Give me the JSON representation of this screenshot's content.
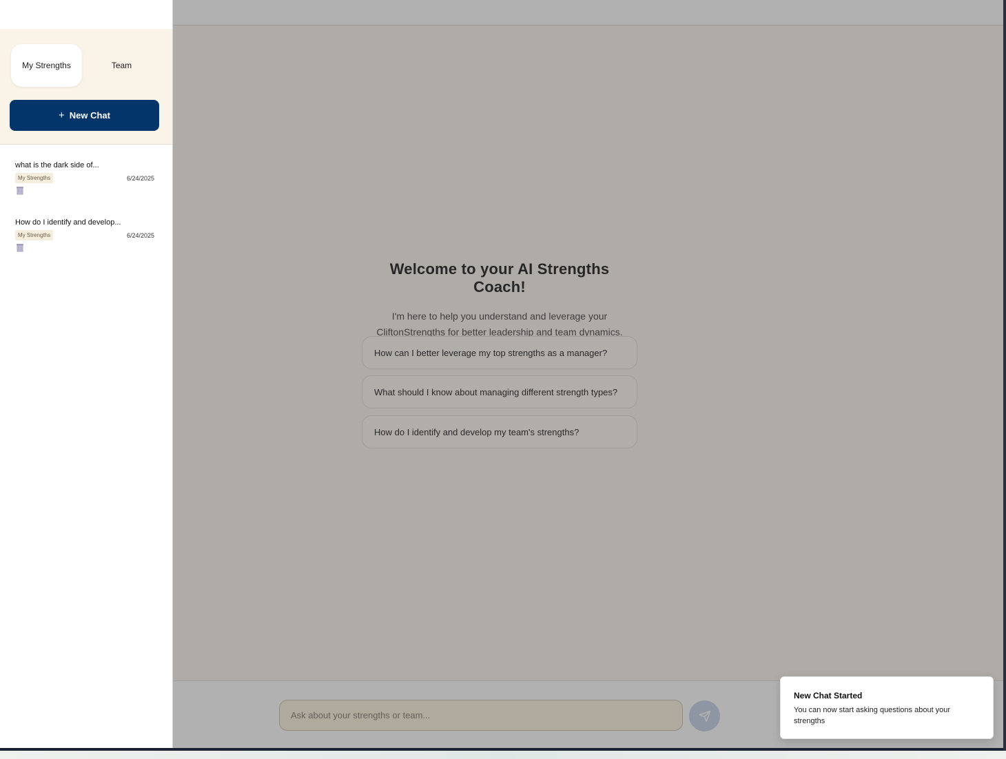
{
  "sidebar": {
    "tabs": [
      {
        "label": "My Strengths",
        "active": true
      },
      {
        "label": "Team",
        "active": false
      }
    ],
    "new_chat": {
      "icon": "plus-icon",
      "label": "New Chat"
    },
    "chats": [
      {
        "title": "what is the dark side of...",
        "badge": "My Strengths",
        "date": "6/24/2025"
      },
      {
        "title": "How do I identify and develop...",
        "badge": "My Strengths",
        "date": "6/24/2025"
      }
    ]
  },
  "main": {
    "welcome_title": "Welcome to your AI Strengths Coach!",
    "welcome_subtitle": "I'm here to help you understand and leverage your CliftonStrengths for better leadership and team dynamics.",
    "suggestions": [
      "How can I better leverage my top strengths as a manager?",
      "What should I know about managing different strength types?",
      "How do I identify and develop my team's strengths?"
    ],
    "input": {
      "placeholder": "Ask about your strengths or team...",
      "value": ""
    },
    "send_icon": "send-icon"
  },
  "toast": {
    "title": "New Chat Started",
    "body": "You can now start asking questions about your strengths"
  },
  "colors": {
    "primary": "#04356a",
    "sidebar_header_bg": "#faf3e8",
    "badge_bg": "#f5eedf",
    "overlay": "rgba(70,70,70,0.42)"
  }
}
